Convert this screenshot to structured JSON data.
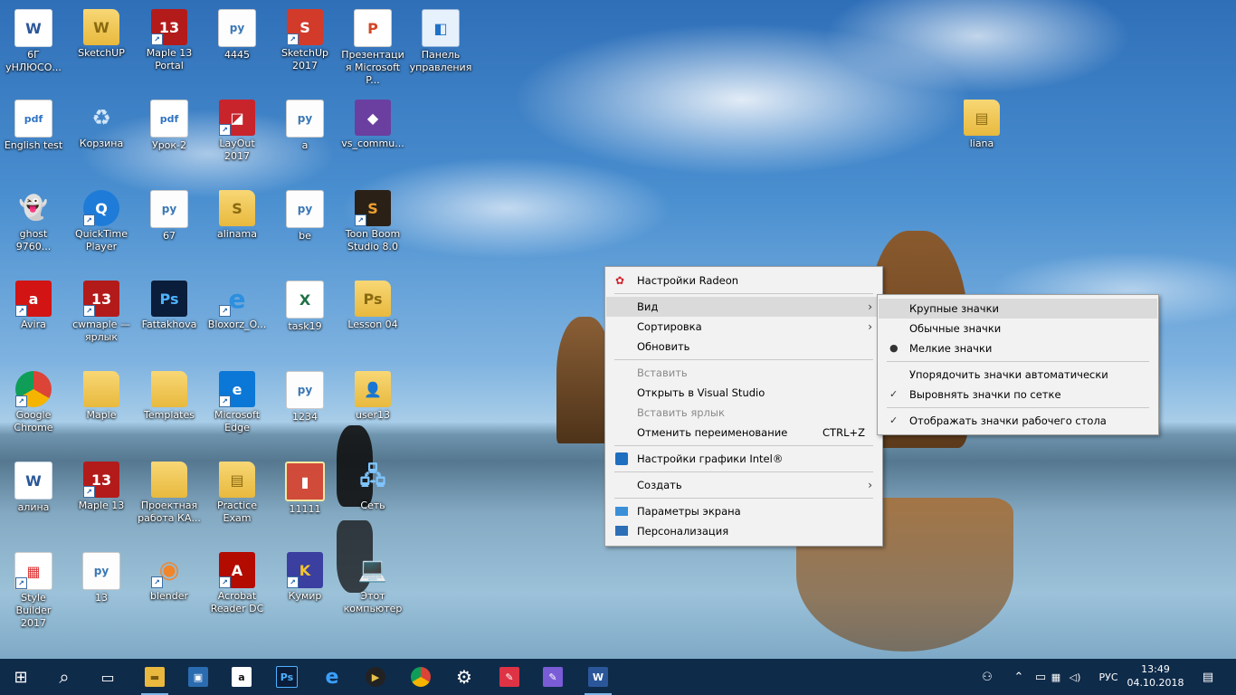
{
  "desktop": {
    "icons": [
      {
        "label": "6Г уНЛЮСО...",
        "glyph": "W",
        "type": "word",
        "shortcut": false
      },
      {
        "label": "SketchUP",
        "glyph": "W",
        "type": "folder",
        "shortcut": false
      },
      {
        "label": "Maple 13 Portal",
        "glyph": "13",
        "type": "maple",
        "shortcut": true
      },
      {
        "label": "4445",
        "glyph": "py",
        "type": "doc",
        "shortcut": false
      },
      {
        "label": "SketchUp 2017",
        "glyph": "S",
        "type": "red",
        "shortcut": true
      },
      {
        "label": "Презентация Microsoft P...",
        "glyph": "P",
        "type": "ppt",
        "shortcut": false
      },
      {
        "label": "Панель управления",
        "glyph": "◧",
        "type": "panel",
        "shortcut": false
      },
      {
        "label": "English test",
        "glyph": "pdf",
        "type": "pdf",
        "shortcut": false
      },
      {
        "label": "Корзина",
        "glyph": "♻",
        "type": "bin",
        "shortcut": false
      },
      {
        "label": "Урок-2",
        "glyph": "pdf",
        "type": "pdf",
        "shortcut": false
      },
      {
        "label": "LayOut 2017",
        "glyph": "◪",
        "type": "layout",
        "shortcut": true
      },
      {
        "label": "a",
        "glyph": "py",
        "type": "doc",
        "shortcut": false
      },
      {
        "label": "vs_commu...",
        "glyph": "◆",
        "type": "vs",
        "shortcut": false
      },
      {
        "label": "ghost 9760...",
        "glyph": "👻",
        "type": "ghost",
        "shortcut": false
      },
      {
        "label": "QuickTime Player",
        "glyph": "Q",
        "type": "qt",
        "shortcut": true
      },
      {
        "label": "67",
        "glyph": "py",
        "type": "doc",
        "shortcut": false
      },
      {
        "label": "alinama",
        "glyph": "S",
        "type": "folder",
        "shortcut": false
      },
      {
        "label": "be",
        "glyph": "py",
        "type": "doc",
        "shortcut": false
      },
      {
        "label": "Toon Boom Studio 8.0",
        "glyph": "S",
        "type": "toon",
        "shortcut": true
      },
      {
        "label": "Avira",
        "glyph": "a",
        "type": "avira",
        "shortcut": true
      },
      {
        "label": "cwmaple — ярлык",
        "glyph": "13",
        "type": "maple",
        "shortcut": true
      },
      {
        "label": "Fattakhova",
        "glyph": "Ps",
        "type": "ps",
        "shortcut": false
      },
      {
        "label": "Bloxorz_O...",
        "glyph": "e",
        "type": "ie",
        "shortcut": true
      },
      {
        "label": "task19",
        "glyph": "X",
        "type": "excel",
        "shortcut": false
      },
      {
        "label": "Lesson 04",
        "glyph": "Ps",
        "type": "folder",
        "shortcut": false
      },
      {
        "label": "Google Chrome",
        "glyph": "",
        "type": "chrome",
        "shortcut": true
      },
      {
        "label": "Maple",
        "glyph": "",
        "type": "folder",
        "shortcut": false
      },
      {
        "label": "Templates",
        "glyph": "",
        "type": "folder",
        "shortcut": false
      },
      {
        "label": "Microsoft Edge",
        "glyph": "e",
        "type": "edge",
        "shortcut": true
      },
      {
        "label": "1234",
        "glyph": "py",
        "type": "doc",
        "shortcut": false
      },
      {
        "label": "user13",
        "glyph": "👤",
        "type": "user",
        "shortcut": false
      },
      {
        "label": "алина",
        "glyph": "W",
        "type": "word",
        "shortcut": false
      },
      {
        "label": "Maple 13",
        "glyph": "13",
        "type": "maple",
        "shortcut": true
      },
      {
        "label": "Проектная работа КА...",
        "glyph": "",
        "type": "folder",
        "shortcut": false
      },
      {
        "label": "Practice Exam",
        "glyph": "▤",
        "type": "folder",
        "shortcut": false
      },
      {
        "label": "11111",
        "glyph": "▮",
        "type": "red2",
        "shortcut": false
      },
      {
        "label": "Сеть",
        "glyph": "🖧",
        "type": "net",
        "shortcut": false
      },
      {
        "label": "Style Builder 2017",
        "glyph": "▦",
        "type": "style",
        "shortcut": true
      },
      {
        "label": "13",
        "glyph": "py",
        "type": "doc",
        "shortcut": false
      },
      {
        "label": "blender",
        "glyph": "◉",
        "type": "blender",
        "shortcut": true
      },
      {
        "label": "Acrobat Reader DC",
        "glyph": "A",
        "type": "acrobat",
        "shortcut": true
      },
      {
        "label": "Кумир",
        "glyph": "K",
        "type": "kumir",
        "shortcut": true
      },
      {
        "label": "Этот компьютер",
        "glyph": "💻",
        "type": "pc",
        "shortcut": false
      },
      {
        "label": "liana",
        "glyph": "▤",
        "type": "folder",
        "shortcut": false
      }
    ]
  },
  "context_menu": {
    "items": [
      {
        "label": "Настройки Radeon",
        "icon": "radeon-icon"
      },
      {
        "label": "Вид",
        "submenu": true,
        "highlighted": true
      },
      {
        "label": "Сортировка",
        "submenu": true
      },
      {
        "label": "Обновить"
      },
      {
        "label": "Вставить",
        "disabled": true
      },
      {
        "label": "Открыть в Visual Studio"
      },
      {
        "label": "Вставить ярлык",
        "disabled": true
      },
      {
        "label": "Отменить переименование",
        "shortcut": "CTRL+Z"
      },
      {
        "label": "Настройки графики Intel®",
        "icon": "intel-graphics-icon"
      },
      {
        "label": "Создать",
        "submenu": true
      },
      {
        "label": "Параметры экрана",
        "icon": "display-icon"
      },
      {
        "label": "Персонализация",
        "icon": "personalize-icon"
      }
    ]
  },
  "view_submenu": {
    "items": [
      {
        "label": "Крупные значки",
        "highlighted": true
      },
      {
        "label": "Обычные значки"
      },
      {
        "label": "Мелкие значки",
        "mark": "●"
      },
      {
        "label": "Упорядочить значки автоматически"
      },
      {
        "label": "Выровнять значки по сетке",
        "mark": "✓"
      },
      {
        "label": "Отображать значки рабочего стола",
        "mark": "✓"
      }
    ]
  },
  "taskbar": {
    "pinned": [
      {
        "name": "start-button",
        "glyph": "⊞"
      },
      {
        "name": "search-button",
        "glyph": "⌕"
      },
      {
        "name": "task-view-button",
        "glyph": "▭"
      },
      {
        "name": "file-explorer-button",
        "glyph": "▬"
      },
      {
        "name": "store-button",
        "glyph": "▣"
      },
      {
        "name": "amazon-button",
        "glyph": "a"
      },
      {
        "name": "photoshop-button",
        "glyph": "Ps"
      },
      {
        "name": "edge-button",
        "glyph": "e"
      },
      {
        "name": "media-player-button",
        "glyph": "▶"
      },
      {
        "name": "chrome-button",
        "glyph": ""
      },
      {
        "name": "settings-button",
        "glyph": "⚙"
      },
      {
        "name": "paint-button",
        "glyph": "✎"
      },
      {
        "name": "paint3d-button",
        "glyph": "✎"
      },
      {
        "name": "word-button",
        "glyph": "W"
      }
    ],
    "tray": {
      "people_glyph": "⚇",
      "chevron_glyph": "⌃",
      "battery_glyph": "▭",
      "network_glyph": "▦",
      "volume_glyph": "◁)",
      "language": "РУС",
      "time": "13:49",
      "date": "04.10.2018",
      "notification_glyph": "▤"
    }
  }
}
